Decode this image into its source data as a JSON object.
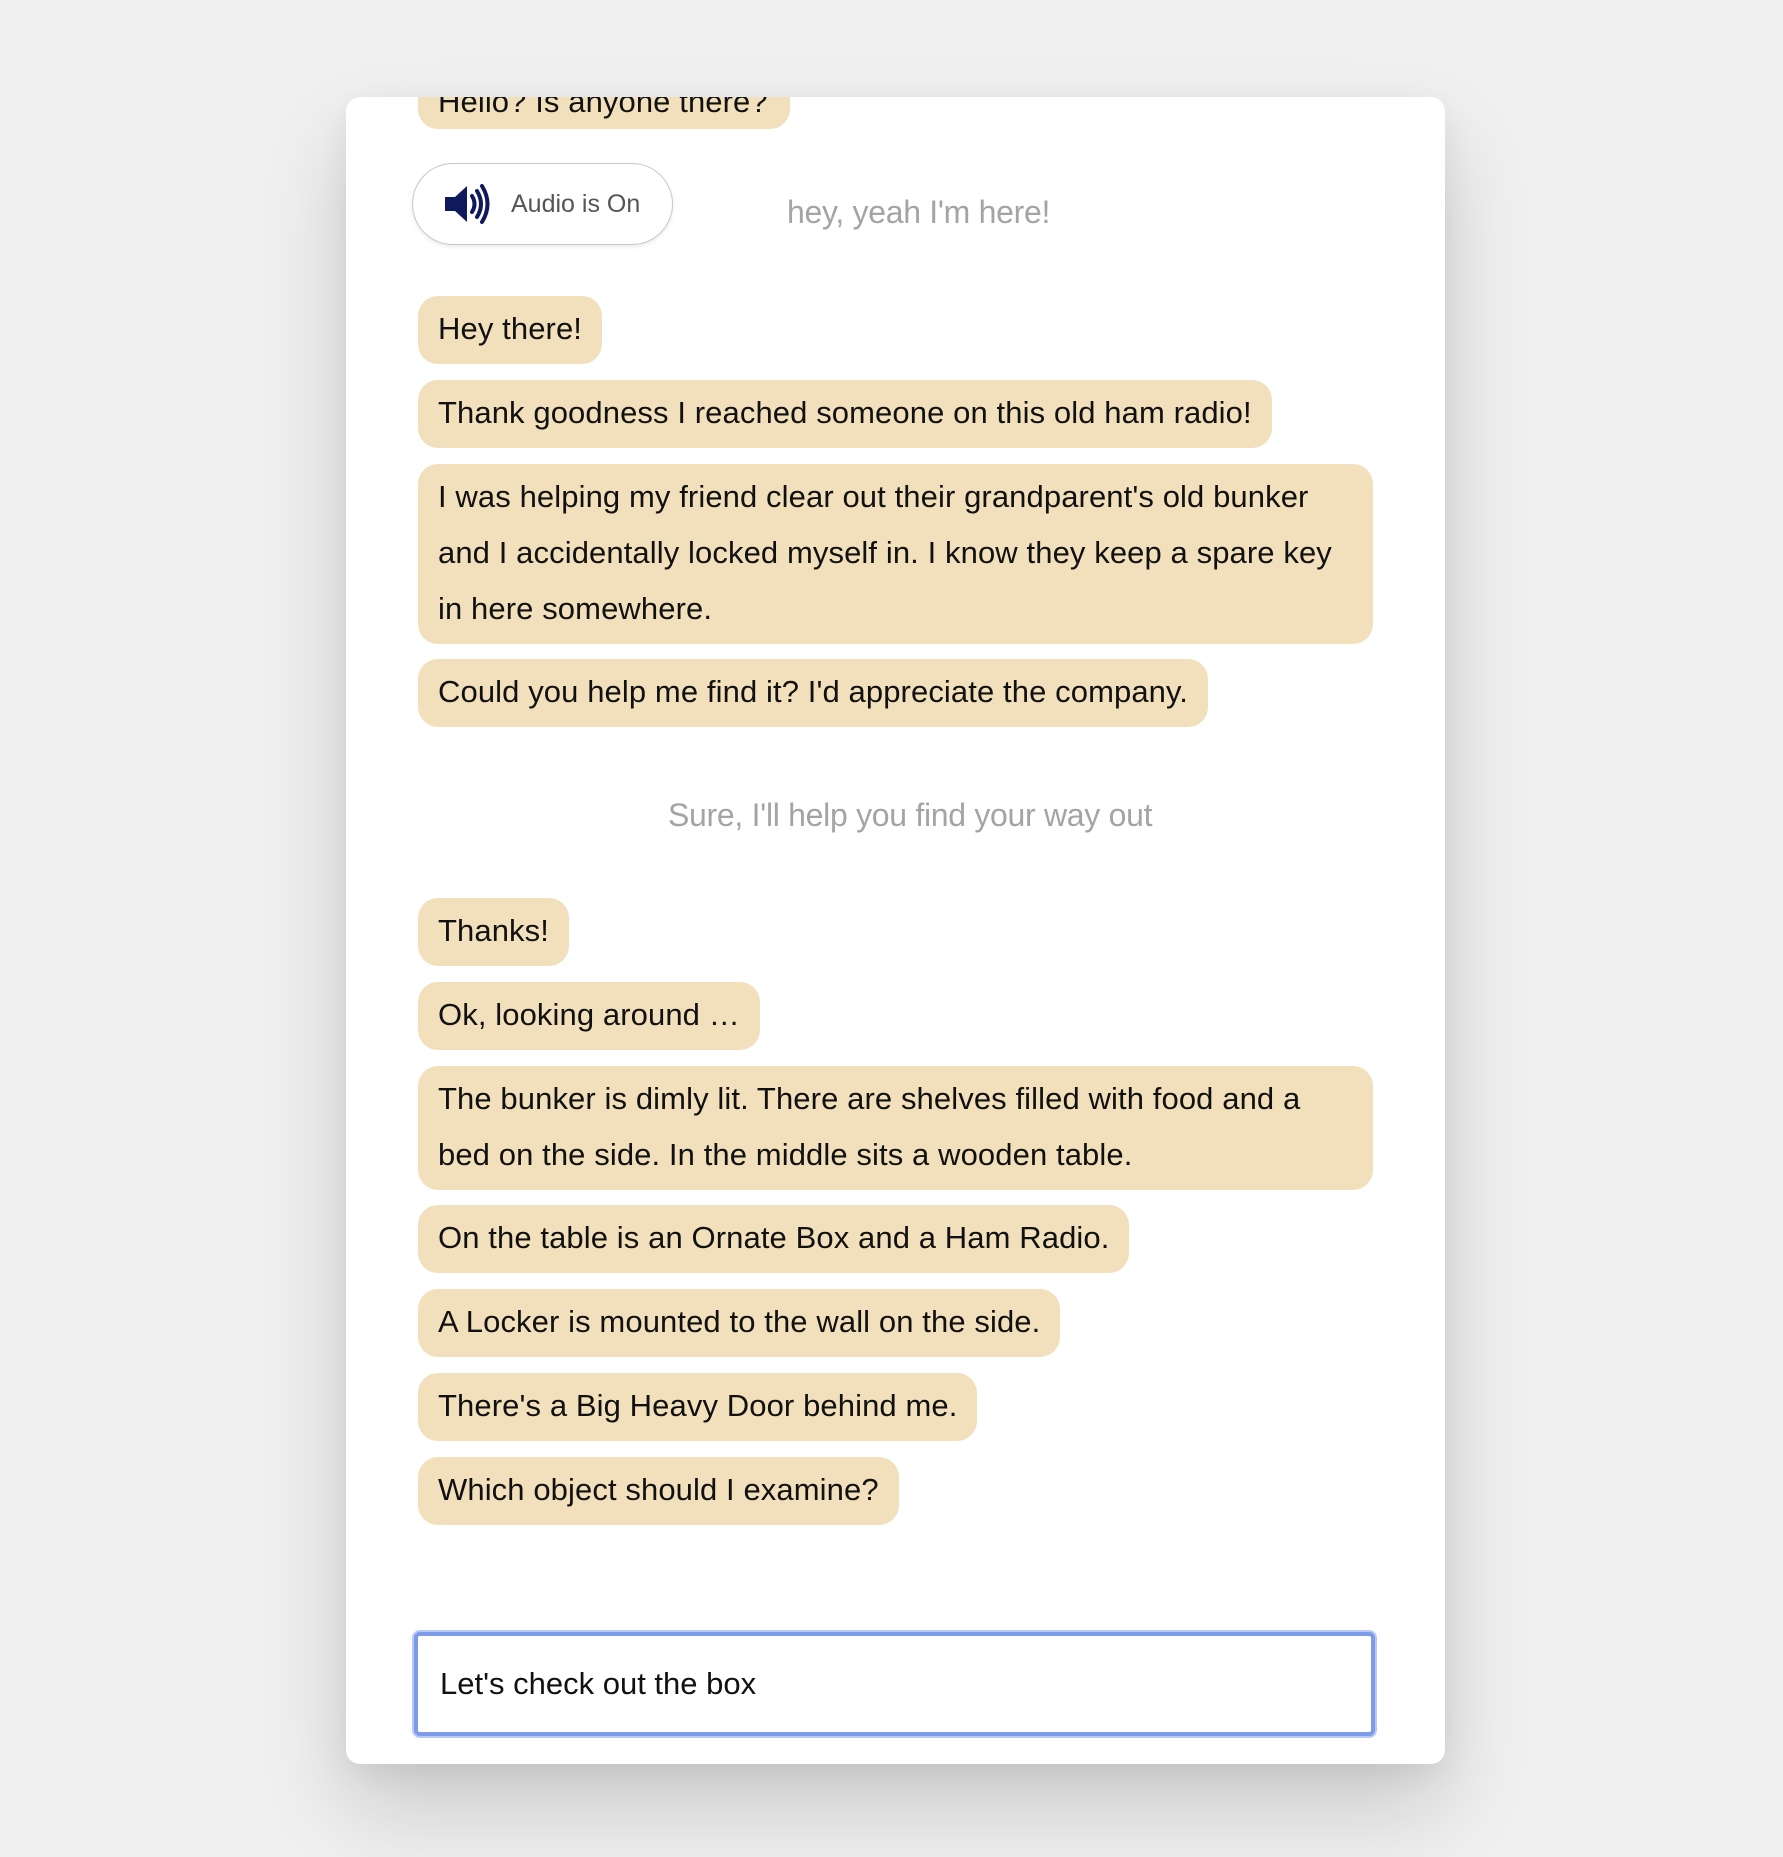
{
  "audio_button": {
    "label": "Audio is On",
    "icon": "speaker-icon"
  },
  "messages": {
    "partial_top": "Hello? Is anyone there?",
    "user_reply_1": "hey, yeah I'm here!",
    "bot_1": "Hey there!",
    "bot_2": "Thank goodness I reached someone on this old ham radio!",
    "bot_3": "I was helping my friend clear out their grandparent's old bunker and I accidentally locked myself in. I know they keep a spare key in here somewhere.",
    "bot_4": "Could you help me find it? I'd appreciate the company.",
    "user_reply_2": "Sure, I'll help you find your way out",
    "bot_5": "Thanks!",
    "bot_6": "Ok, looking around …",
    "bot_7": "The bunker is dimly lit. There are shelves filled with food and a bed on the side. In the middle sits a wooden table.",
    "bot_8": "On the table is an Ornate Box and a Ham Radio.",
    "bot_9": "A Locker is mounted to the wall on the side.",
    "bot_10": "There's a Big Heavy Door behind me.",
    "bot_11": "Which object should I examine?"
  },
  "input": {
    "value": "Let's check out the box"
  },
  "colors": {
    "page_background": "#f0f0f0",
    "bubble": "#f2dfbc",
    "user_reply_text": "#a4a4a4",
    "input_focus_border": "#7d9be8",
    "speaker_icon": "#0f1a5c"
  }
}
